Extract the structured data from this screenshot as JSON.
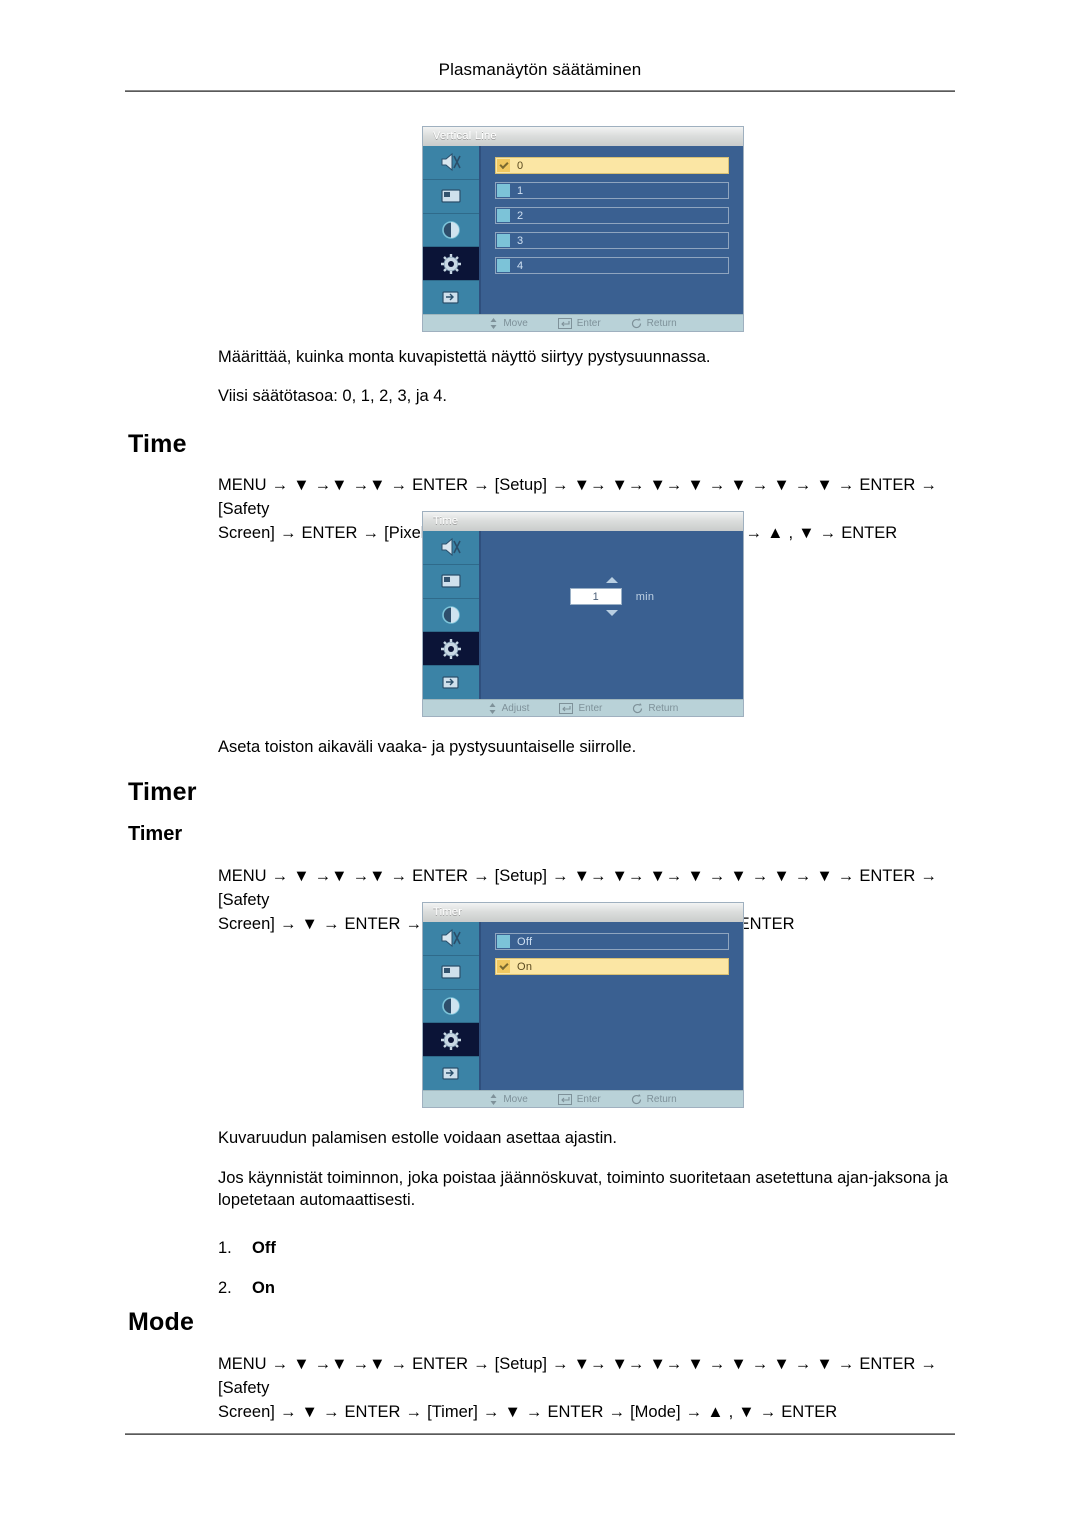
{
  "document": {
    "header": "Plasmanäytön säätäminen"
  },
  "sections": [
    {
      "id": "vertical-line",
      "osd": {
        "title": "Vertical Line",
        "type": "list",
        "options": [
          {
            "label": "0",
            "selected": true
          },
          {
            "label": "1",
            "selected": false
          },
          {
            "label": "2",
            "selected": false
          },
          {
            "label": "3",
            "selected": false
          },
          {
            "label": "4",
            "selected": false
          }
        ],
        "footer": [
          {
            "icon": "updown-arrow-icon",
            "label": "Move"
          },
          {
            "icon": "enter-key-icon",
            "label": "Enter"
          },
          {
            "icon": "return-arrow-icon",
            "label": "Return"
          }
        ],
        "sidebar_icons": [
          "speaker-icon",
          "picture-icon",
          "contrast-icon",
          "gear-icon",
          "input-source-icon"
        ],
        "sidebar_selected_index": 3
      },
      "paragraphs": [
        "Määrittää, kuinka monta kuvapistettä näyttö siirtyy pystysuunnassa.",
        "Viisi säätötasoa: 0, 1, 2, 3, ja 4."
      ]
    },
    {
      "id": "time",
      "heading": "Time",
      "path_line1": "MENU → ▼ →▼ →▼ → ENTER → [Setup] → ▼→ ▼→ ▼→ ▼ → ▼ → ▼ → ▼ → ENTER → [Safety",
      "path_line2": "Screen] → ENTER → [Pixel Shift] → ▼ →▼ →▼ → ENTER → [Time] → ▲ , ▼ → ENTER",
      "osd": {
        "title": "Time",
        "type": "spinner",
        "value": "1",
        "unit": "min",
        "footer": [
          {
            "icon": "updown-arrow-icon",
            "label": "Adjust"
          },
          {
            "icon": "enter-key-icon",
            "label": "Enter"
          },
          {
            "icon": "return-arrow-icon",
            "label": "Return"
          }
        ],
        "sidebar_selected_index": 3
      },
      "paragraphs": [
        "Aseta toiston aikaväli vaaka- ja pystysuuntaiselle siirrolle."
      ]
    },
    {
      "id": "timer",
      "heading": "Timer",
      "subheading": "Timer",
      "path_line1": "MENU → ▼ →▼ →▼ → ENTER → [Setup] → ▼→ ▼→ ▼→ ▼ → ▼ → ▼ → ▼ → ENTER → [Safety",
      "path_line2": "Screen] → ▼ → ENTER → [Timer] → ENTER → [Timer] → ▲ , ▼ → ENTER",
      "osd": {
        "title": "Timer",
        "type": "list",
        "options": [
          {
            "label": "Off",
            "selected": false
          },
          {
            "label": "On",
            "selected": true
          }
        ],
        "footer": [
          {
            "icon": "updown-arrow-icon",
            "label": "Move"
          },
          {
            "icon": "enter-key-icon",
            "label": "Enter"
          },
          {
            "icon": "return-arrow-icon",
            "label": "Return"
          }
        ],
        "sidebar_selected_index": 3
      },
      "paragraphs": [
        "Kuvaruudun palamisen estolle voidaan asettaa ajastin.",
        "Jos käynnistät toiminnon, joka poistaa jäännöskuvat, toiminto suoritetaan asetettuna ajan-jaksona ja lopetetaan automaattisesti."
      ],
      "numbered_list": [
        {
          "num": "1.",
          "value": "Off"
        },
        {
          "num": "2.",
          "value": "On"
        }
      ]
    },
    {
      "id": "mode",
      "heading": "Mode",
      "path_line1": "MENU → ▼ →▼ →▼ → ENTER → [Setup] → ▼→ ▼→ ▼→ ▼ → ▼ → ▼ → ▼ → ENTER → [Safety",
      "path_line2": "Screen] → ▼ → ENTER → [Timer] → ▼ → ENTER → [Mode] → ▲ , ▼ → ENTER"
    }
  ],
  "colors": {
    "osd_background": "#3a6091",
    "osd_sidebar": "#3b83a6",
    "osd_selected_row": "#fbe6a4",
    "osd_footer": "#b9d2d8",
    "rule": "#5a5a5a"
  }
}
